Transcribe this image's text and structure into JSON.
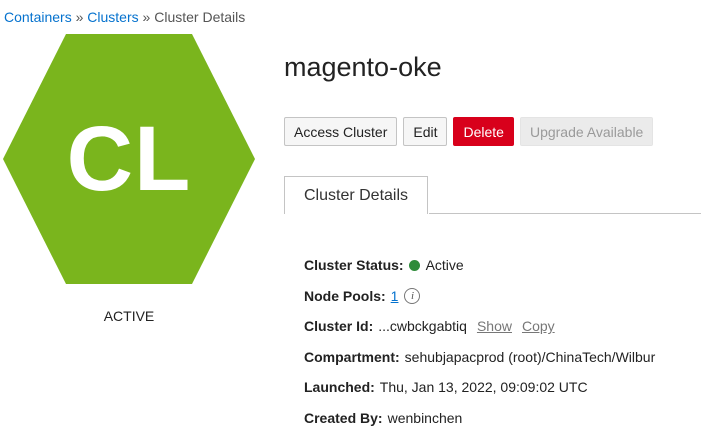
{
  "breadcrumb": {
    "items": [
      "Containers",
      "Clusters"
    ],
    "current": "Cluster Details",
    "separator": "»"
  },
  "cluster_icon": {
    "initials": "CL",
    "color": "#7ab51d",
    "state": "ACTIVE"
  },
  "title": "magento-oke",
  "actions": {
    "access": "Access Cluster",
    "edit": "Edit",
    "delete": "Delete",
    "upgrade": "Upgrade Available"
  },
  "tabs": [
    "Cluster Details"
  ],
  "details": {
    "status": {
      "label": "Cluster Status:",
      "value": "Active",
      "color": "#2e8b3a"
    },
    "node_pools": {
      "label": "Node Pools:",
      "value": "1",
      "info_icon": "info-icon"
    },
    "cluster_id": {
      "label": "Cluster Id:",
      "value": "...cwbckgabtiq",
      "show": "Show",
      "copy": "Copy"
    },
    "compartment": {
      "label": "Compartment:",
      "value": "sehubjapacprod (root)/ChinaTech/Wilbur"
    },
    "launched": {
      "label": "Launched:",
      "value": "Thu, Jan 13, 2022, 09:09:02 UTC"
    },
    "created_by": {
      "label": "Created By:",
      "value": "wenbinchen"
    }
  }
}
